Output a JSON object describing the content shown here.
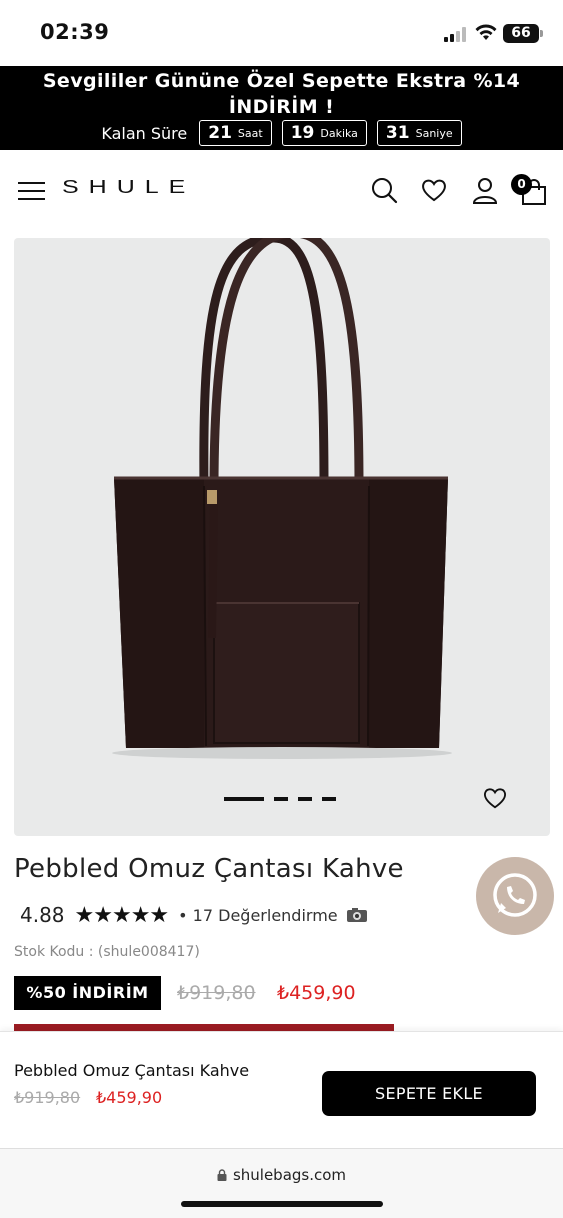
{
  "status_bar": {
    "time": "02:39",
    "battery": "66"
  },
  "promo": {
    "title": "Sevgililer Gününe Özel Sepette Ekstra %14 İNDİRİM !",
    "countdown_label": "Kalan Süre",
    "countdown": [
      {
        "value": "21",
        "unit": "Saat"
      },
      {
        "value": "19",
        "unit": "Dakika"
      },
      {
        "value": "31",
        "unit": "Saniye"
      }
    ]
  },
  "header": {
    "logo": "SHULE",
    "cart_count": "0",
    "icons": [
      "menu-icon",
      "search-icon",
      "heart-icon",
      "user-icon",
      "bag-icon"
    ]
  },
  "product": {
    "title": "Pebbled Omuz Çantası Kahve",
    "rating": "4.88",
    "stars": "★★★★★",
    "reviews": "• 17 Değerlendirme",
    "sku": "Stok Kodu : (shule008417)",
    "discount_label": "%50 İNDİRİM",
    "old_price": "₺919,80",
    "new_price": "₺459,90",
    "gallery_pages": 4,
    "gallery_active_page": 1
  },
  "sticky_bar": {
    "title": "Pebbled Omuz Çantası Kahve",
    "old_price": "₺919,80",
    "new_price": "₺459,90",
    "add_to_cart": "SEPETE EKLE"
  },
  "browser": {
    "url": "shulebags.com"
  },
  "colors": {
    "accent_red": "#d22222",
    "bar_red": "#9b1c22",
    "whatsapp_bg": "#c9b7aa"
  }
}
